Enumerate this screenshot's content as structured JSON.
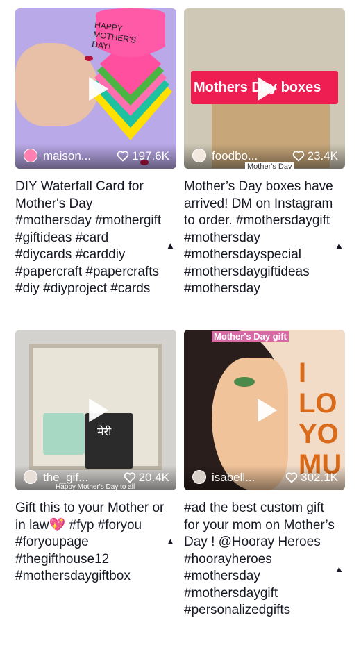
{
  "videos": [
    {
      "username": "maison...",
      "likes": "197.6K",
      "caption": "DIY Waterfall Card for Mother's Day #mothersday #mothergift #giftideas #card #diycards #carddiy #papercraft #papercrafts #diy #diyproject #cards",
      "thumb_text": "HAPPY MOTHER'S DAY!"
    },
    {
      "username": "foodbo...",
      "likes": "23.4K",
      "caption": "Mother’s Day boxes have arrived! DM on Instagram to order. #mothersdaygift #mothersday #mothersdayspecial #mothersdaygiftideas #mothersday",
      "thumb_text": "Mothers Day boxes",
      "thumb_subtext": "Mother's Day"
    },
    {
      "username": "the_gif...",
      "likes": "20.4K",
      "caption": "Gift this to your Mother or in law💖 #fyp #foryou #foryoupage #thegifthouse12 #mothersdaygiftbox",
      "thumb_text": "मेरी",
      "thumb_subtext": "Happy Mother's Day to all"
    },
    {
      "username": "isabell...",
      "likes": "302.1K",
      "caption": "#ad the best custom gift for your mom on Mother’s Day ! @Hooray Heroes #hoorayheroes #mothersday #mothersdaygift #personalizedgifts",
      "thumb_text": "Mother's Day gift",
      "thumb_subtext": "I LO YO MU"
    }
  ],
  "icons": {
    "like": "heart-outline-icon",
    "play": "play-icon",
    "expand": "caret-up-icon"
  },
  "colors": {
    "accent": "#ee1d52",
    "text": "#161823"
  }
}
